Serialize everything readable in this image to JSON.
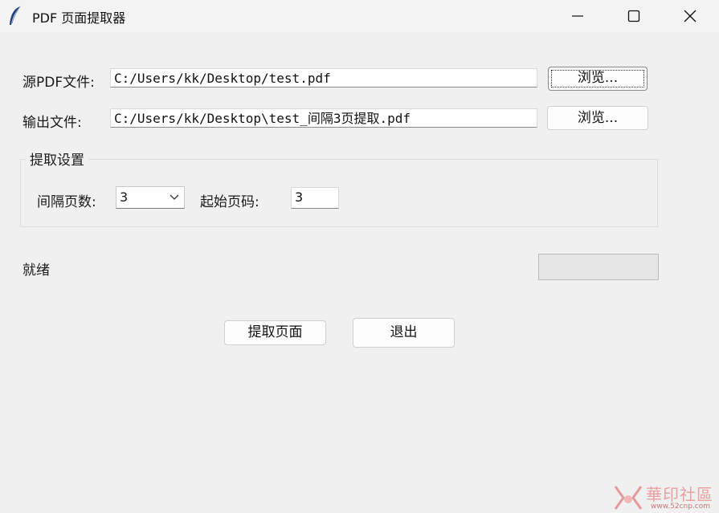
{
  "window": {
    "title": "PDF 页面提取器",
    "icon": "feather-icon",
    "controls": [
      "minimize-icon",
      "maximize-icon",
      "close-icon"
    ]
  },
  "source": {
    "label": "源PDF文件:",
    "value": "C:/Users/kk/Desktop/test.pdf",
    "browse_label": "浏览..."
  },
  "output": {
    "label": "输出文件:",
    "value": "C:/Users/kk/Desktop\\test_间隔3页提取.pdf",
    "browse_label": "浏览..."
  },
  "settings": {
    "title": "提取设置",
    "interval_label": "间隔页数:",
    "interval_value": "3",
    "start_label": "起始页码:",
    "start_value": "3"
  },
  "status": {
    "text": "就绪",
    "progress": 0
  },
  "actions": {
    "extract_label": "提取页面",
    "exit_label": "退出"
  },
  "watermark": {
    "text": "華印社區",
    "sub": "www.52cnp.com"
  },
  "colors": {
    "background": "#f0f0f0",
    "titlebar": "#f3f3f3",
    "progress_fill": "#06b025"
  }
}
